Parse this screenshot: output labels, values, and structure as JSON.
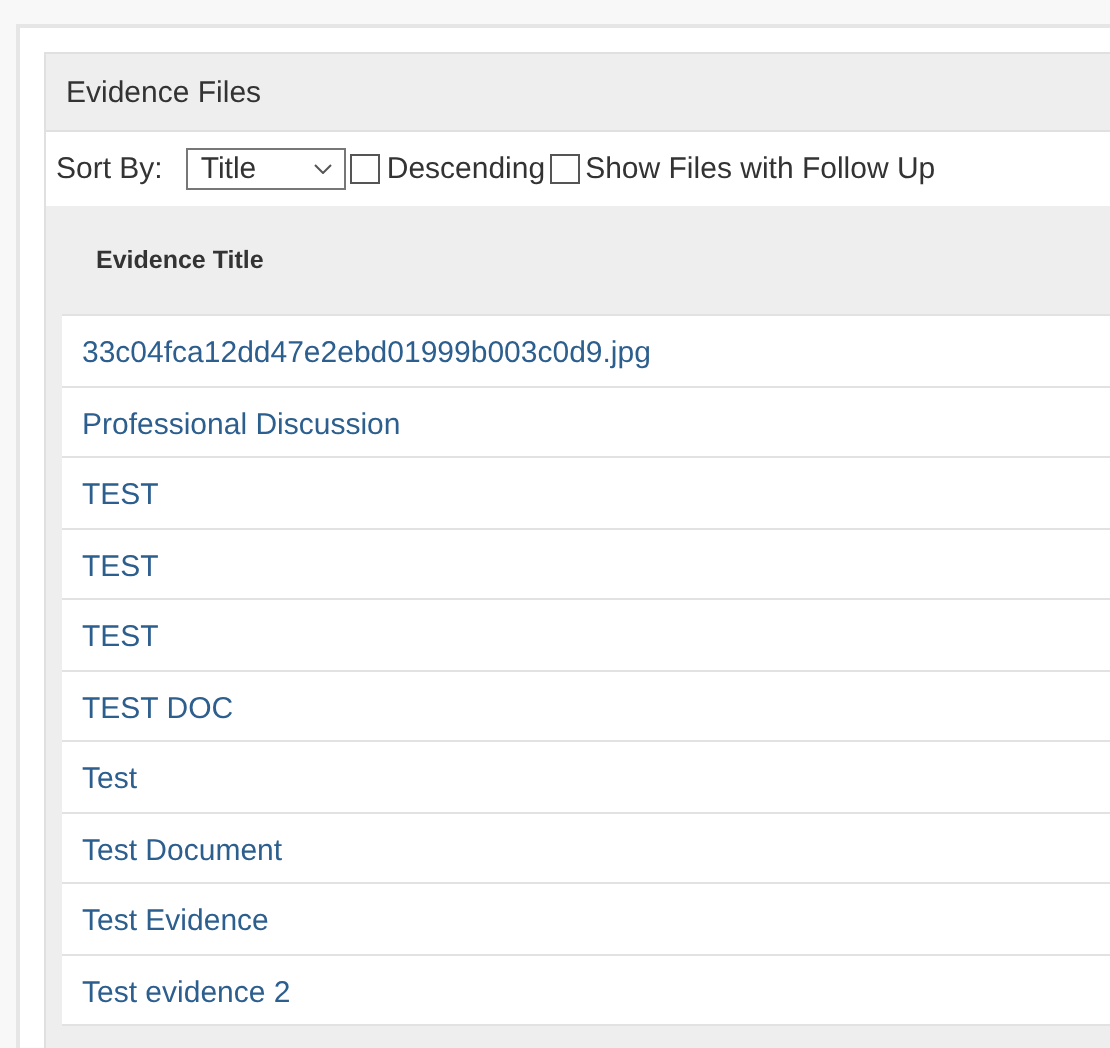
{
  "panel": {
    "title": "Evidence Files"
  },
  "toolbar": {
    "sort_label": "Sort By:",
    "sort_value": "Title",
    "options": [
      {
        "label": "Descending",
        "checked": false
      },
      {
        "label": "Show Files with Follow Up",
        "checked": false
      }
    ]
  },
  "table": {
    "columns": [
      "Evidence Title"
    ],
    "rows": [
      "33c04fca12dd47e2ebd01999b003c0d9.jpg",
      "Professional Discussion",
      "TEST",
      "TEST",
      "TEST",
      "TEST DOC",
      "Test",
      "Test Document",
      "Test Evidence",
      "Test evidence 2"
    ]
  }
}
